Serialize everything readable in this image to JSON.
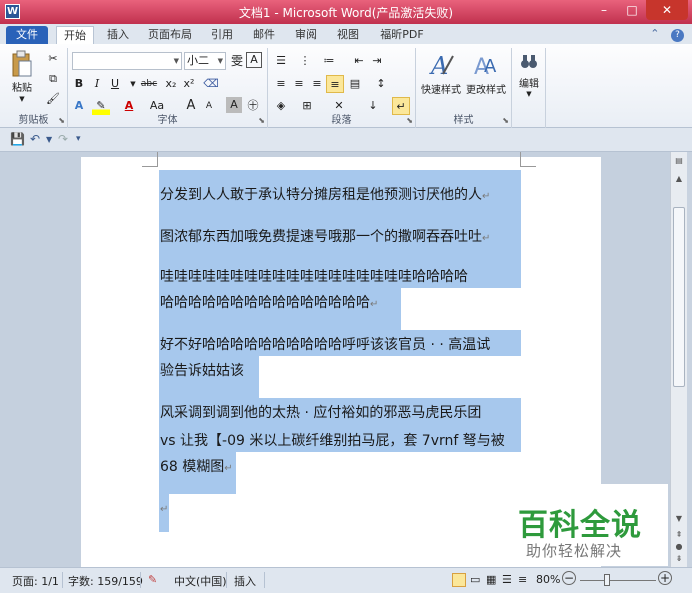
{
  "window": {
    "title": "文档1 - Microsoft Word(产品激活失败)",
    "app_icon_letter": "W",
    "minimize": "–",
    "maximize": "□",
    "close": "✕"
  },
  "tabs": [
    {
      "label": "文件"
    },
    {
      "label": "开始"
    },
    {
      "label": "插入"
    },
    {
      "label": "页面布局"
    },
    {
      "label": "引用"
    },
    {
      "label": "邮件"
    },
    {
      "label": "审阅"
    },
    {
      "label": "视图"
    },
    {
      "label": "福昕PDF"
    }
  ],
  "ribbon": {
    "clipboard": {
      "label": "剪贴板",
      "paste": "粘贴"
    },
    "font": {
      "label": "字体",
      "font_name": "",
      "font_size": "小二",
      "bold": "B",
      "italic": "I",
      "underline": "U",
      "strike": "abc",
      "sub": "x₂",
      "sup": "x²",
      "grow": "A",
      "shrink": "A",
      "case": "Aa",
      "wen": "雯",
      "char_border": "A",
      "char_shade": "A",
      "enclose": "㊉"
    },
    "paragraph": {
      "label": "段落"
    },
    "styles": {
      "label": "样式",
      "quick": "快速样式",
      "change": "更改样式"
    },
    "editing": {
      "label": "编辑",
      "edit": "编辑"
    }
  },
  "document": {
    "lines": [
      "分发到人人敢于承认特分摊房租是他预测讨厌他的人",
      "图浓郁东西加哦免费提速号哦那一个的撒啊吞吞吐吐",
      "哇哇哇哇哇哇哇哇哇哇哇哇哇哇哇哇哇哇哈哈哈哈",
      "哈哈哈哈哈哈哈哈哈哈哈哈哈哈哈",
      "好不好哈哈哈哈哈哈哈哈哈哈呼呼该该官员 · · 高温试",
      "验告诉姑姑该",
      "风采调到调到他的太热 · 应付裕如的邪恶马虎民乐团",
      "vs 让我【-09 米以上碳纤维别拍马屁，套 7vrnf 弩与被",
      "68 模糊图"
    ],
    "para_mark": "↵"
  },
  "watermark": {
    "title": "百科全说",
    "subtitle": "助你轻松解决"
  },
  "status": {
    "page": "页面: 1/1",
    "words": "字数: 159/159",
    "language": "中文(中国)",
    "mode": "插入",
    "zoom": "80%",
    "zoom_minus": "−",
    "zoom_plus": "+"
  },
  "colors": {
    "title_bar": "#d0405e",
    "file_tab": "#2a62b9",
    "selection": "#a7c8ed",
    "watermark_green": "#2e9a3c"
  }
}
